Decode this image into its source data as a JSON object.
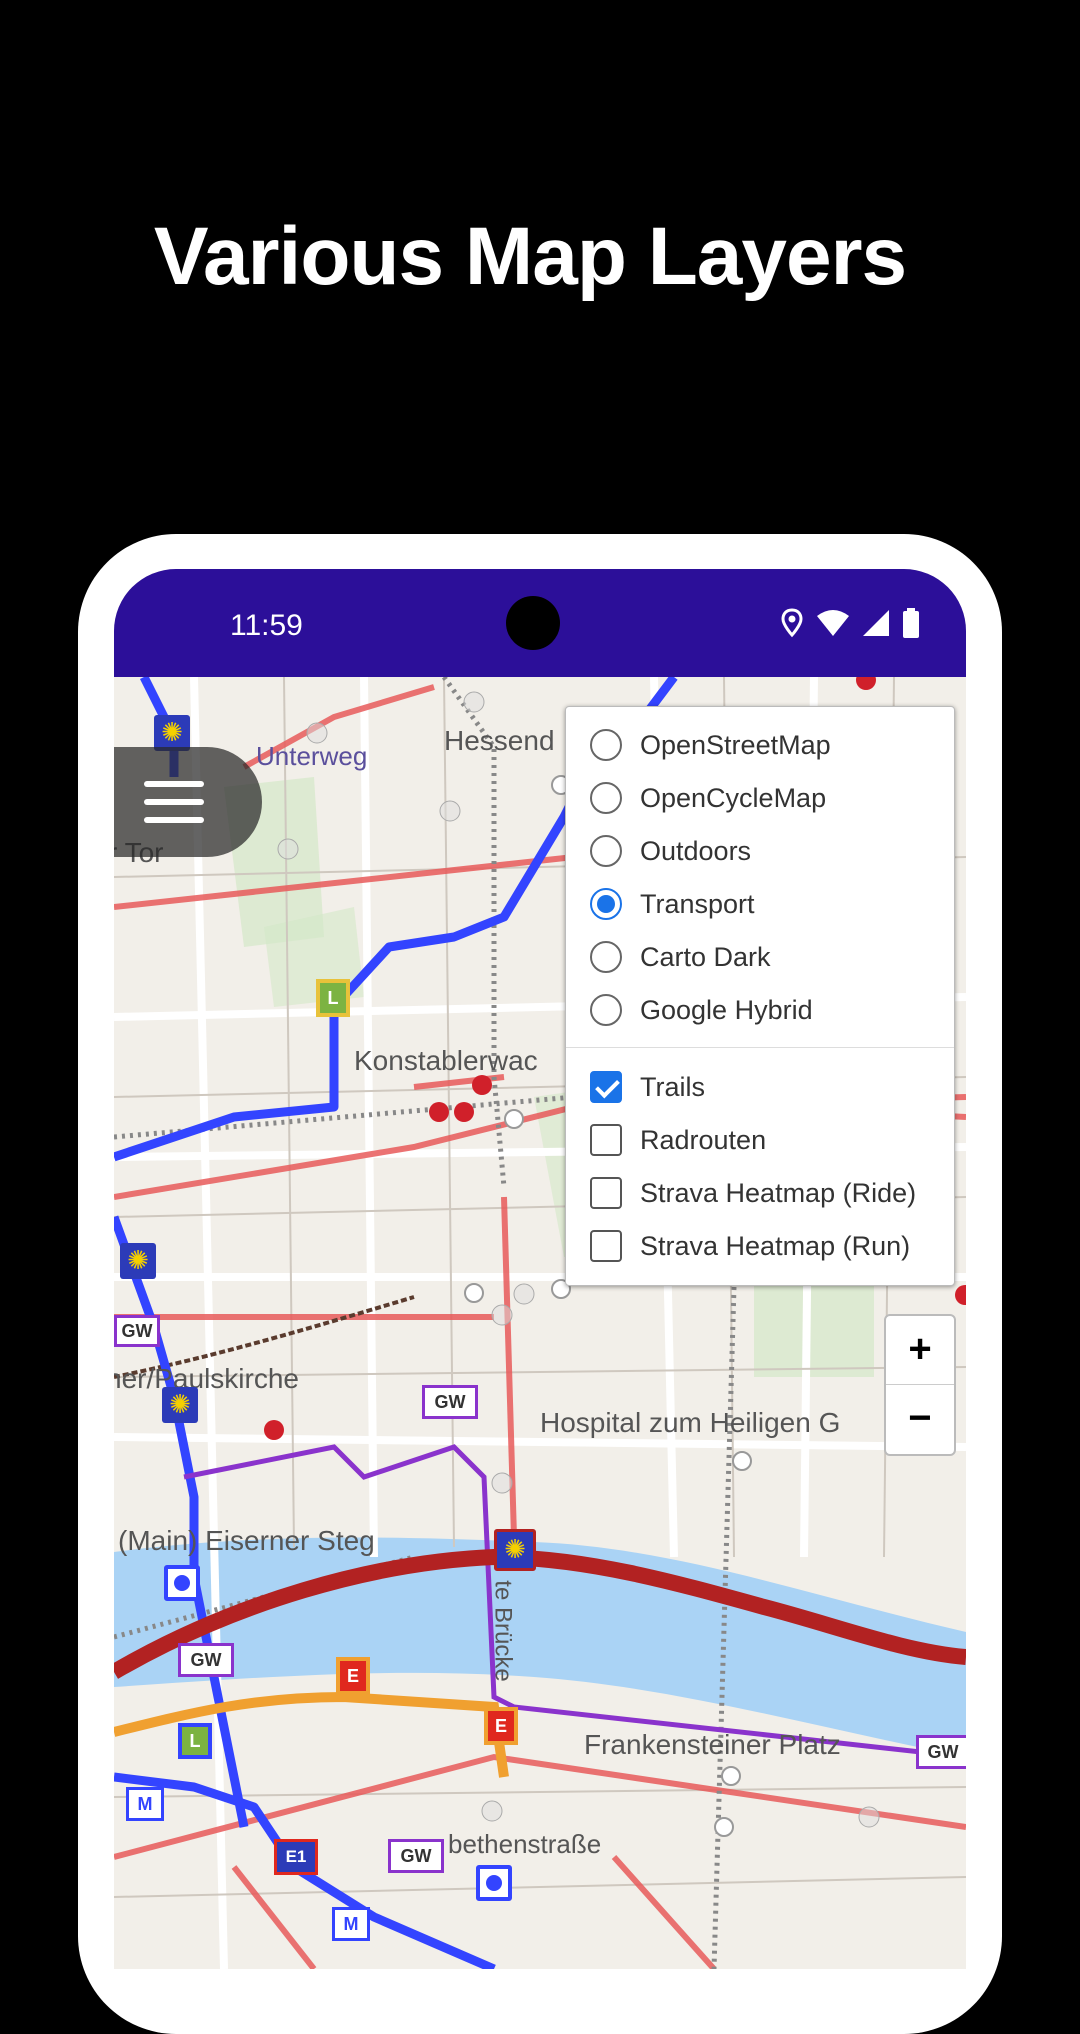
{
  "headline": "Various Map Layers",
  "status_bar": {
    "time": "11:59",
    "icons": [
      "location-icon",
      "wifi-icon",
      "signal-icon",
      "battery-icon"
    ]
  },
  "map": {
    "labels": {
      "unterweg": "Unterweg",
      "hessend": "Hessend",
      "tor": "r Tor",
      "konstablerwac": "Konstablerwac",
      "paulskirche": "ner/Paulskirche",
      "hospital": "Hospital zum Heiligen G",
      "eiserner": "(Main) Eiserner Steg",
      "bruecke": "te Brücke",
      "frankensteiner": "Frankensteiner Platz",
      "bethenstrasse": "bethenstraße"
    },
    "badges": {
      "gw": "GW",
      "l": "L",
      "e": "E",
      "m": "M",
      "e1": "E1"
    }
  },
  "layers": {
    "base": [
      {
        "label": "OpenStreetMap",
        "selected": false
      },
      {
        "label": "OpenCycleMap",
        "selected": false
      },
      {
        "label": "Outdoors",
        "selected": false
      },
      {
        "label": "Transport",
        "selected": true
      },
      {
        "label": "Carto Dark",
        "selected": false
      },
      {
        "label": "Google Hybrid",
        "selected": false
      }
    ],
    "overlays": [
      {
        "label": "Trails",
        "checked": true
      },
      {
        "label": "Radrouten",
        "checked": false
      },
      {
        "label": "Strava Heatmap (Ride)",
        "checked": false
      },
      {
        "label": "Strava Heatmap (Run)",
        "checked": false
      }
    ]
  },
  "zoom": {
    "in": "+",
    "out": "−"
  },
  "colors": {
    "status_bar": "#2c0f99",
    "accent": "#1a73e8",
    "trail_blue": "#3344ff",
    "river": "#aad3f5",
    "main_road": "#e04848"
  }
}
